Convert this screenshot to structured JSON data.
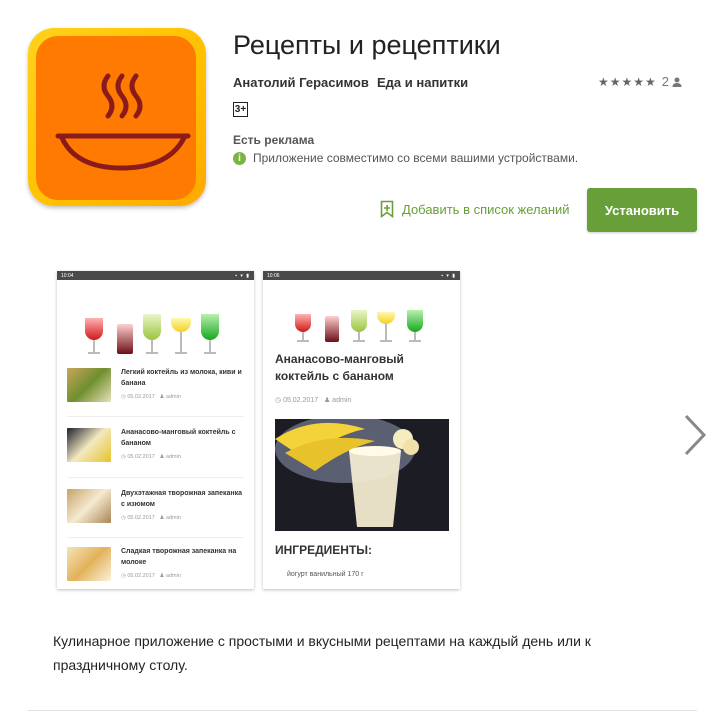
{
  "app": {
    "title": "Рецепты и рецептики",
    "developer": "Анатолий Герасимов",
    "category": "Еда и напитки",
    "rating_stars": "★★★★★",
    "rating_count": "2",
    "age_rating": "3+",
    "ads_notice": "Есть реклама",
    "compat_text": "Приложение совместимо со всеми вашими устройствами.",
    "wishlist_label": "Добавить в список желаний",
    "install_label": "Установить",
    "description": "Кулинарное приложение с простыми и вкусными рецептами на каждый день или к праздничному столу.",
    "accent_color": "#689f38",
    "icon_colors": {
      "frame": "#ffc400",
      "inner": "#ff7a00",
      "drawing": "#8b1a1a"
    }
  },
  "screenshots": {
    "shot1": {
      "time": "10:04",
      "items": [
        {
          "title": "Легкий коктейль из молока, киви и банана",
          "date": "05.02.2017",
          "author": "admin"
        },
        {
          "title": "Ананасово-манговый коктейль с бананом",
          "date": "05.02.2017",
          "author": "admin"
        },
        {
          "title": "Двухэтажная творожная запеканка с изюмом",
          "date": "05.02.2017",
          "author": "admin"
        },
        {
          "title": "Сладкая творожная запеканка на молоке",
          "date": "05.02.2017",
          "author": "admin"
        }
      ]
    },
    "shot2": {
      "time": "10:06",
      "article_title": "Ананасово-манговый коктейль с бананом",
      "date": "05.02.2017",
      "author": "admin",
      "ingredients_heading": "ИНГРЕДИЕНТЫ:",
      "ingredient_line": "йогурт ванильный 170 г"
    }
  }
}
